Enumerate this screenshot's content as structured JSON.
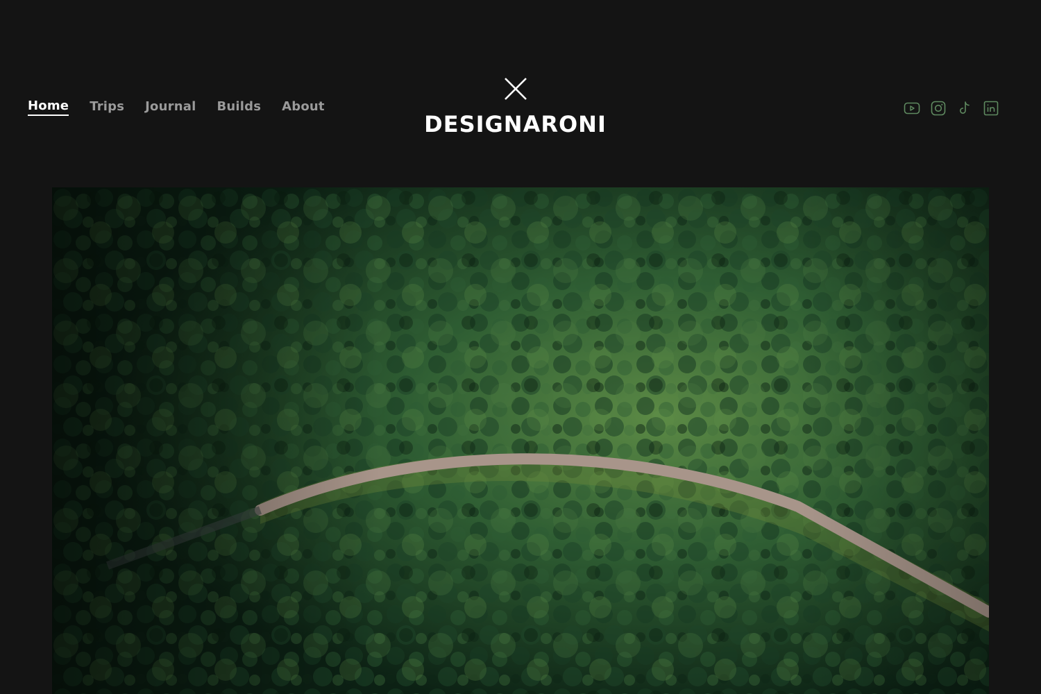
{
  "nav": {
    "items": [
      {
        "label": "Home",
        "active": true
      },
      {
        "label": "Trips",
        "active": false
      },
      {
        "label": "Journal",
        "active": false
      },
      {
        "label": "Builds",
        "active": false
      },
      {
        "label": "About",
        "active": false
      }
    ]
  },
  "brand": {
    "logo_icon": "x-mark-icon",
    "name": "DESIGNARONI"
  },
  "social": {
    "color": "#5f8a60",
    "icons": [
      "youtube-icon",
      "instagram-icon",
      "tiktok-icon",
      "linkedin-icon"
    ]
  },
  "hero": {
    "image": "aerial-forest-road",
    "colors": {
      "forest_dark": "#0e2416",
      "forest_mid": "#1f4a2a",
      "forest_light": "#4f7f3f",
      "road": "#a8958a"
    }
  },
  "theme": {
    "background": "#141414",
    "text_active": "#ffffff",
    "text_inactive": "#9a9a9a"
  }
}
